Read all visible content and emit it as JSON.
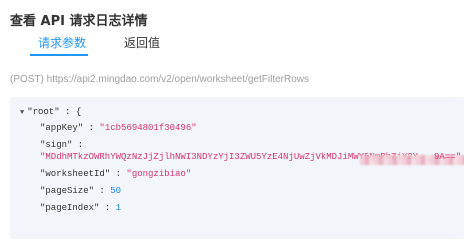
{
  "dialog": {
    "title": "查看 API 请求日志详情"
  },
  "tabs": [
    {
      "label": "请求参数",
      "active": true
    },
    {
      "label": "返回值",
      "active": false
    }
  ],
  "request": {
    "url": "(POST) https://api2.mingdao.com/v2/open/worksheet/getFilterRows"
  },
  "json_view": {
    "root_key": "\"root\"",
    "open_brace": "{",
    "rows": [
      {
        "key": "\"appKey\"",
        "value": "\"1cb5694801f30496\"",
        "type": "string"
      },
      {
        "key": "\"sign\"",
        "value": "",
        "type": "string"
      },
      {
        "key": "\"worksheetId\"",
        "value": "\"gongzibiao\"",
        "type": "string"
      },
      {
        "key": "\"pageSize\"",
        "value": "50",
        "type": "number"
      },
      {
        "key": "\"pageIndex\"",
        "value": "1",
        "type": "number"
      }
    ],
    "sign_value_visible": "\"MDdhMTkzOWRhYWQzNzJjZjlhNWI3NDYzYjI3ZWU5YzE4NjUwZjVkMDJiMWY5NmRhZjY2Y",
    "sign_value_tail": "9A==\"",
    "colon": ":"
  },
  "colors": {
    "accent": "#2196f3",
    "string": "#d6336c",
    "number": "#1e88e5",
    "code_bg": "#f2f6fb"
  }
}
